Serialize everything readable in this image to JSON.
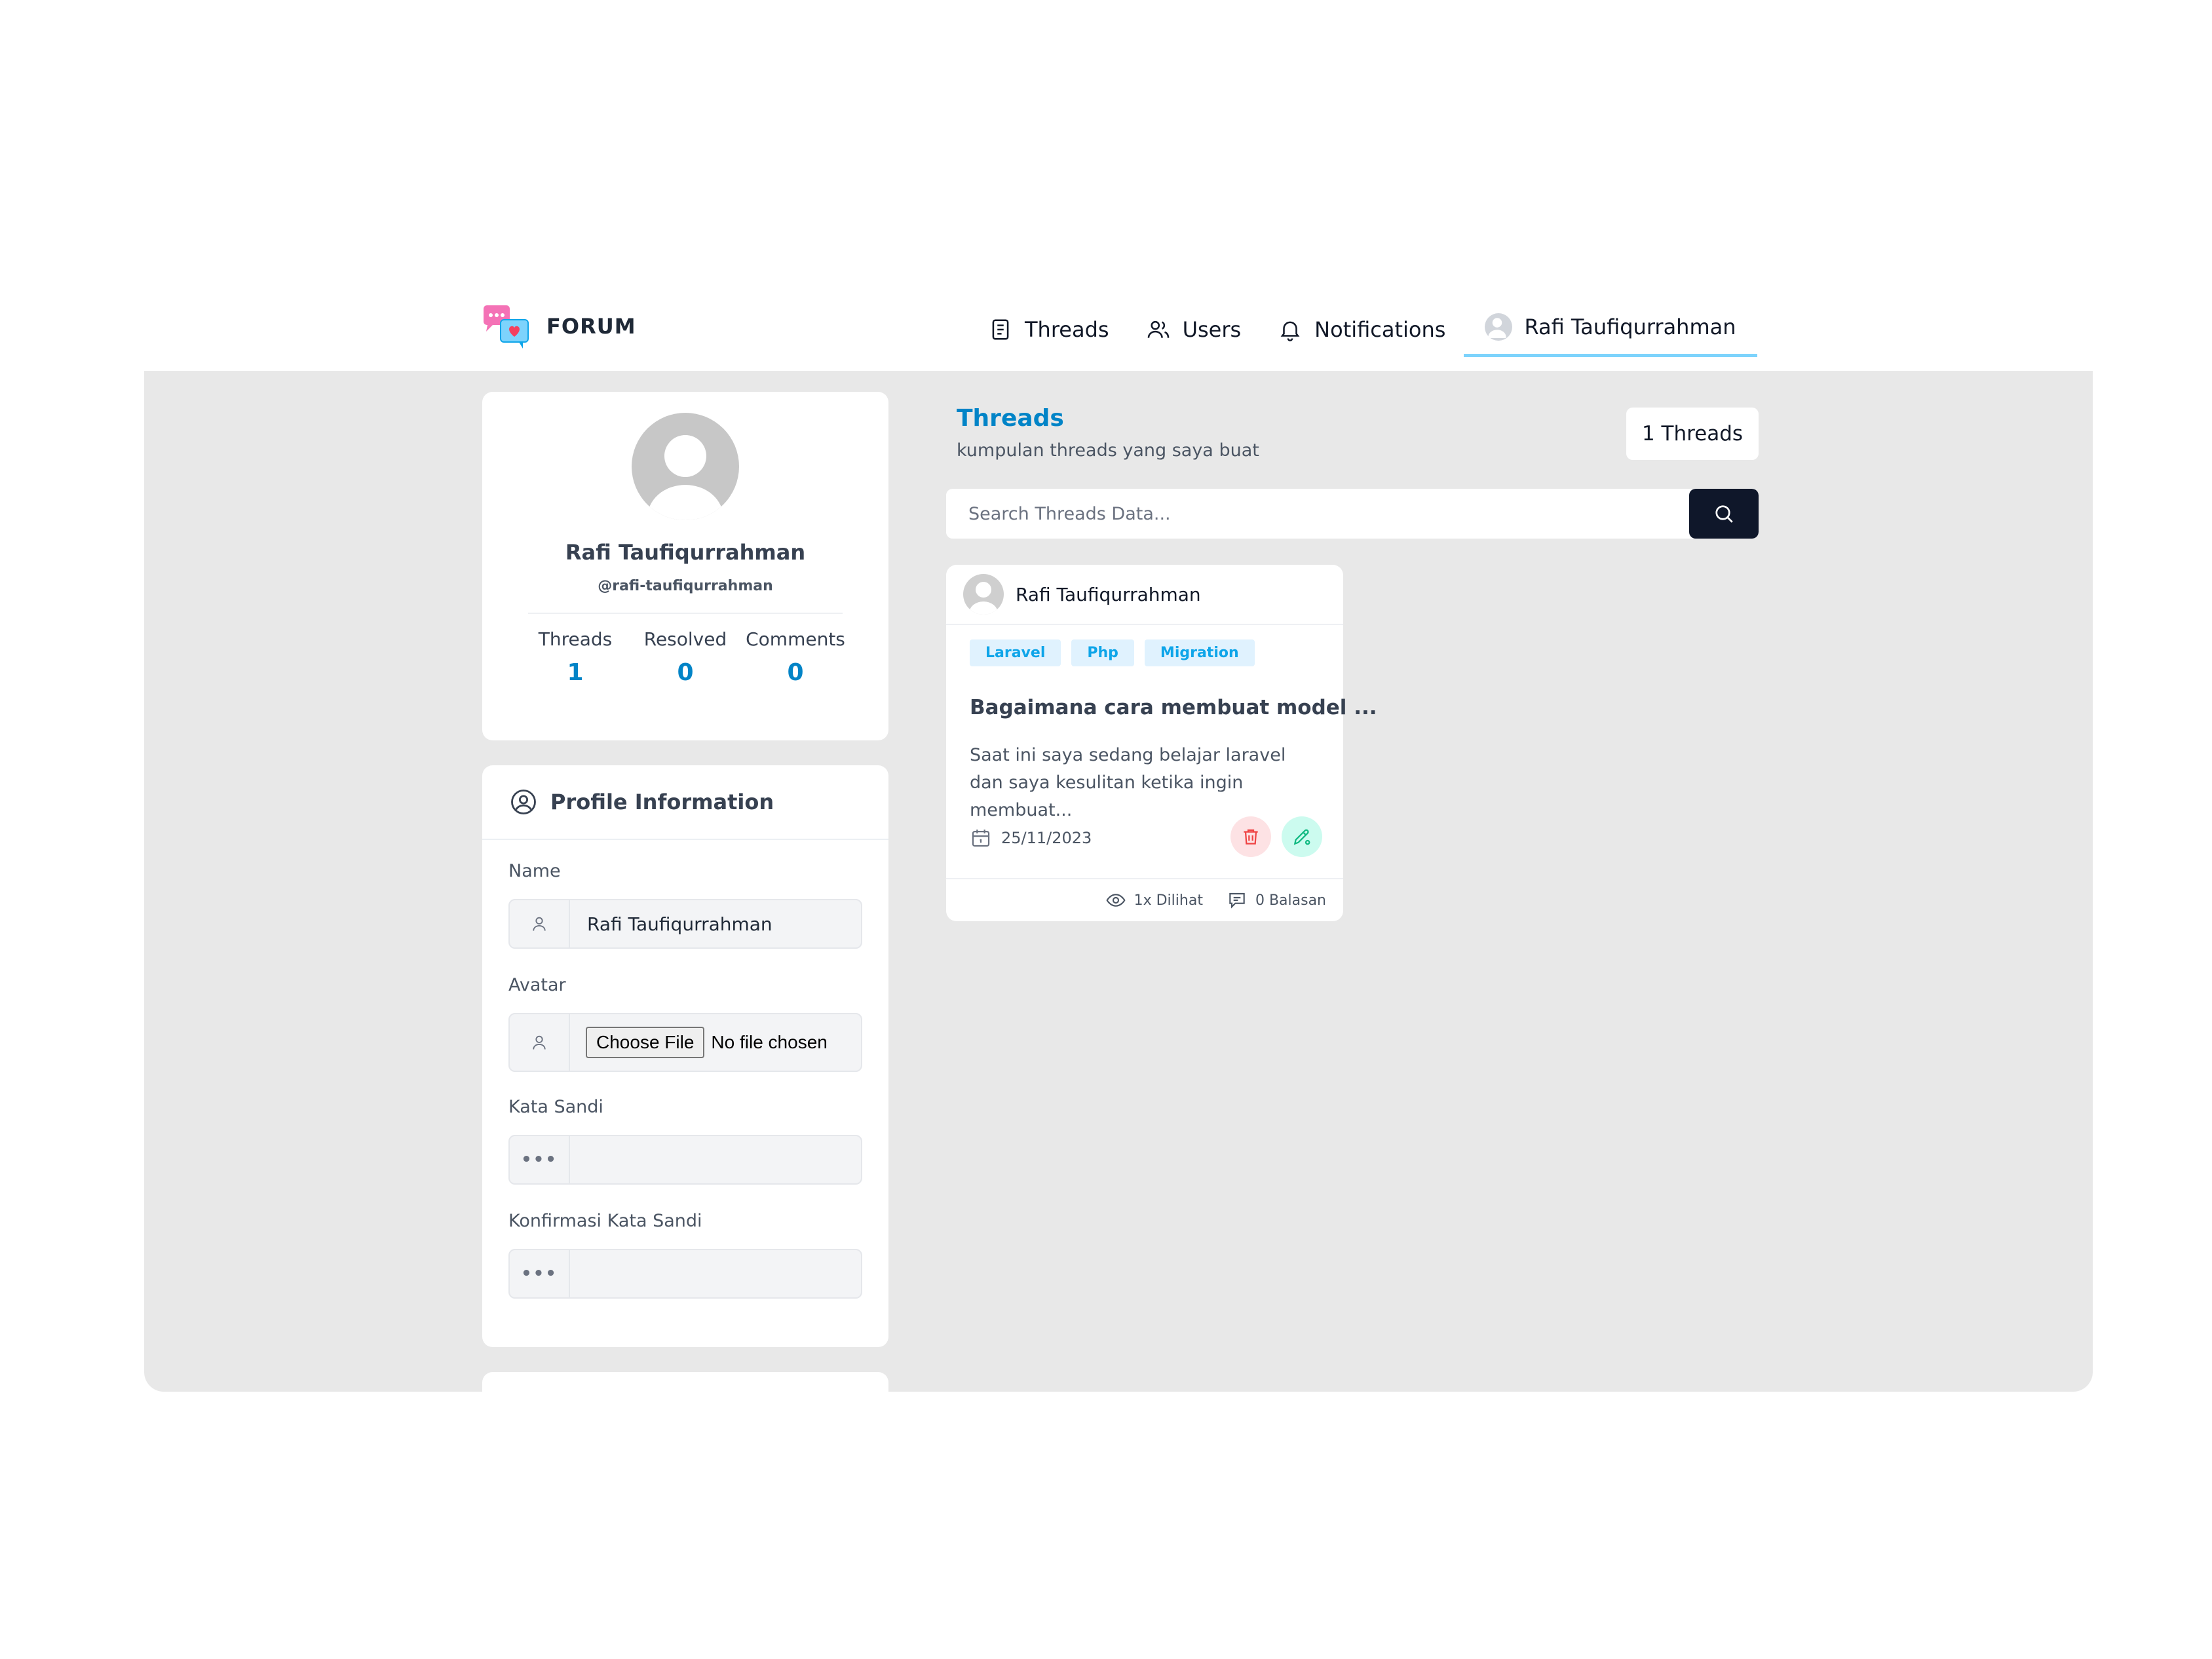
{
  "brand": {
    "name": "FORUM",
    "logo_icon": "chat-bubbles-heart-icon",
    "accent_pink": "#f472b6",
    "accent_blue": "#38bdf8"
  },
  "nav": {
    "threads": "Threads",
    "users": "Users",
    "notifications": "Notifications",
    "profile": "Rafi Taufiqurrahman"
  },
  "profile": {
    "name": "Rafi Taufiqurrahman",
    "handle": "@rafi-taufiqurrahman",
    "stats": [
      {
        "label": "Threads",
        "value": "1"
      },
      {
        "label": "Resolved",
        "value": "0"
      },
      {
        "label": "Comments",
        "value": "0"
      }
    ]
  },
  "profile_info": {
    "title": "Profile Information",
    "name_label": "Name",
    "name_value": "Rafi Taufiqurrahman",
    "avatar_label": "Avatar",
    "file_button": "Choose File",
    "file_status": "No file chosen",
    "password_label": "Kata Sandi",
    "password_icon": "•••",
    "confirm_label": "Konfirmasi Kata Sandi",
    "confirm_icon": "•••"
  },
  "threads_section": {
    "title": "Threads",
    "subtitle": "kumpulan threads yang saya buat",
    "count_badge": "1 Threads",
    "search_placeholder": "Search Threads Data..."
  },
  "thread": {
    "author": "Rafi Taufiqurrahman",
    "tags": [
      "Laravel",
      "Php",
      "Migration"
    ],
    "title": "Bagaimana cara membuat model ...",
    "excerpt": "Saat ini saya sedang belajar laravel dan saya kesulitan ketika ingin membuat...",
    "date": "25/11/2023",
    "views": "1x Dilihat",
    "replies": "0 Balasan"
  },
  "colors": {
    "primary": "#0284c7",
    "background": "#e8e8e8",
    "search_button": "#0f172a",
    "delete": "#ef4444",
    "edit": "#10b981"
  }
}
